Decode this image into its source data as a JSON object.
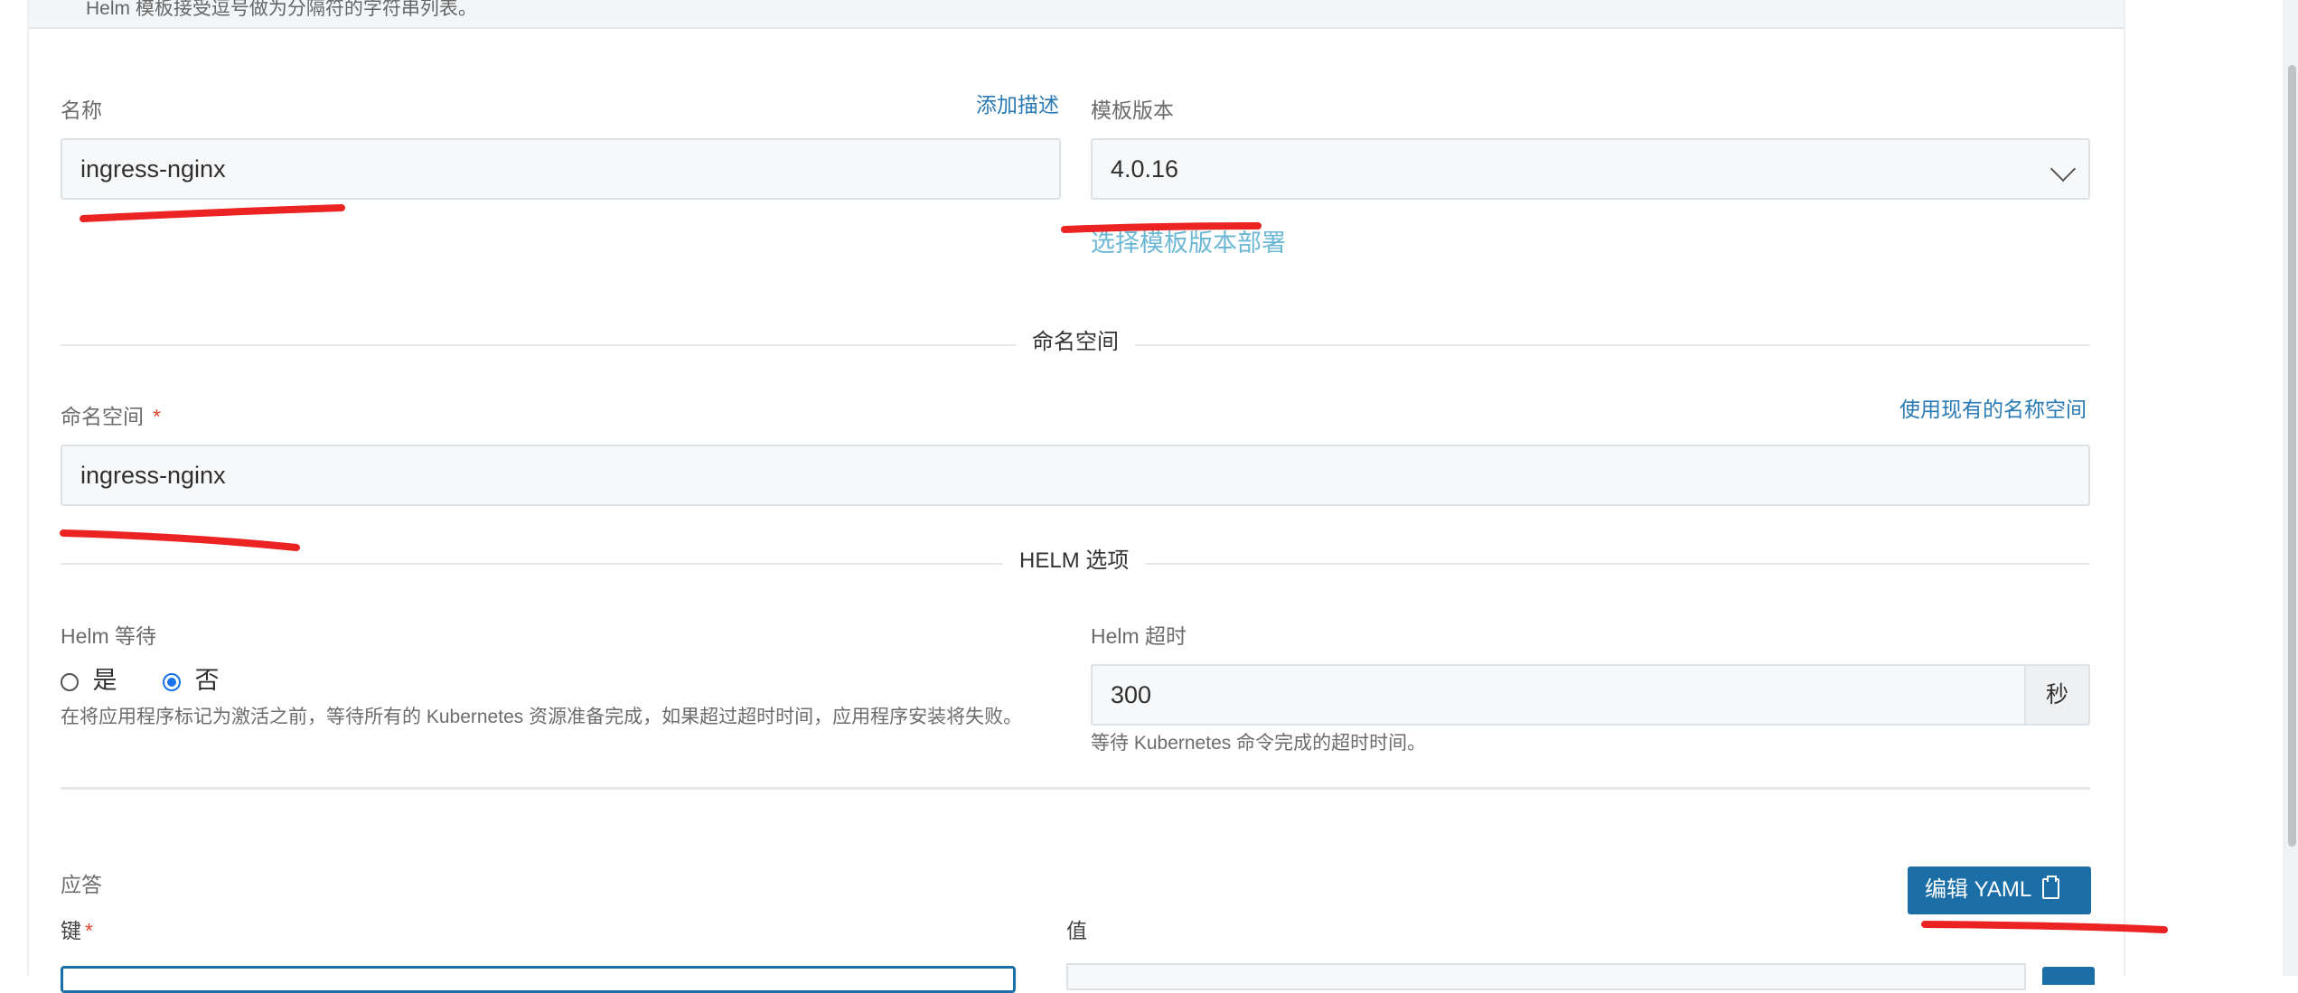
{
  "notice": {
    "text": "Helm 模板接受逗号做为分隔符的字符串列表。"
  },
  "name_field": {
    "label": "名称",
    "add_description_link": "添加描述",
    "value": "ingress-nginx"
  },
  "template_version": {
    "label": "模板版本",
    "value": "4.0.16",
    "select_link": "选择模板版本部署"
  },
  "namespace_section": {
    "heading": "命名空间"
  },
  "namespace_field": {
    "label": "命名空间",
    "required_mark": "*",
    "use_existing_link": "使用现有的名称空间",
    "value": "ingress-nginx"
  },
  "helm_section": {
    "heading": "HELM 选项"
  },
  "helm_wait": {
    "label": "Helm 等待",
    "options": [
      {
        "label": "是",
        "checked": false
      },
      {
        "label": "否",
        "checked": true
      }
    ],
    "help": "在将应用程序标记为激活之前，等待所有的 Kubernetes 资源准备完成，如果超过超时时间，应用程序安装将失败。"
  },
  "helm_timeout": {
    "label": "Helm 超时",
    "value": "300",
    "unit": "秒",
    "help": "等待 Kubernetes 命令完成的超时时间。"
  },
  "answers": {
    "title": "应答",
    "edit_yaml_button": "编辑 YAML",
    "key_label": "键",
    "key_required_mark": "*",
    "value_label": "值"
  },
  "colors": {
    "accent": "#1c6fa6",
    "link": "#2a7ab5",
    "required": "#e1462e",
    "annotation": "#ec2323"
  },
  "icons": {
    "select_chevron": "chevron-down-icon",
    "yaml_button": "clipboard-icon"
  }
}
